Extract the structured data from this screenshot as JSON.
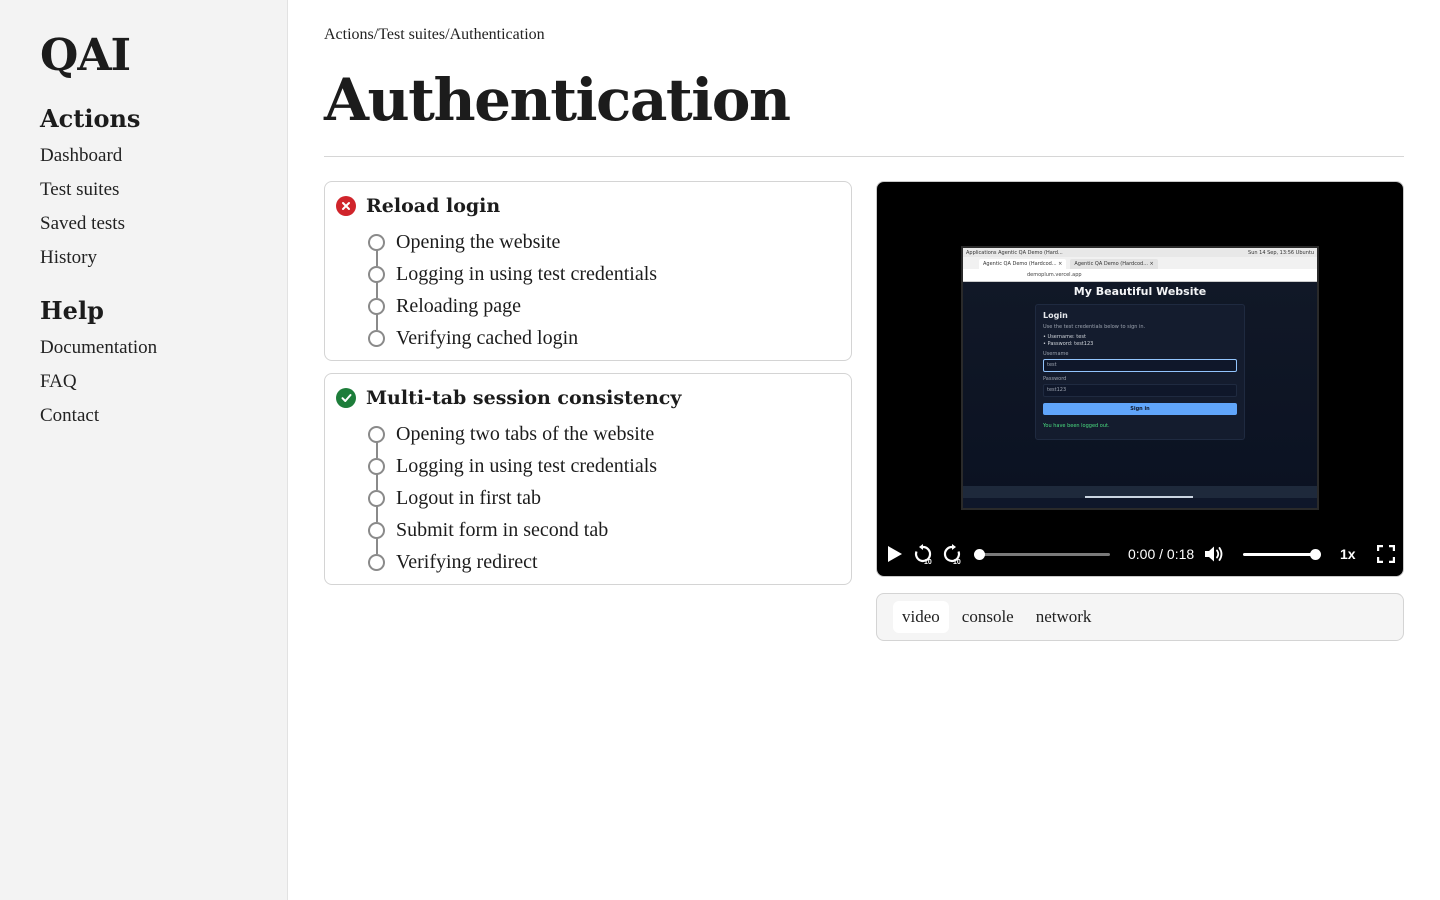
{
  "sidebar": {
    "logo": "QAI",
    "sections": [
      {
        "heading": "Actions",
        "items": [
          "Dashboard",
          "Test suites",
          "Saved tests",
          "History"
        ]
      },
      {
        "heading": "Help",
        "items": [
          "Documentation",
          "FAQ",
          "Contact"
        ]
      }
    ]
  },
  "breadcrumb": [
    "Actions",
    "/",
    "Test suites",
    "/",
    "Authentication"
  ],
  "page_title": "Authentication",
  "tests": [
    {
      "status": "failed",
      "title": "Reload login",
      "steps": [
        "Opening the website",
        "Logging in using test credentials",
        "Reloading page",
        "Verifying cached login"
      ]
    },
    {
      "status": "passed",
      "title": "Multi-tab session consistency",
      "steps": [
        "Opening two tabs of the website",
        "Logging in using test credentials",
        "Logout in first tab",
        "Submit form in second tab",
        "Verifying redirect"
      ]
    }
  ],
  "player": {
    "time": "0:00 / 0:18",
    "speed": "1x",
    "progress": 0.0,
    "volume": 1.0,
    "rewind_label": "10",
    "forward_label": "10",
    "frame": {
      "os_bar_left": "Applications   Agentic QA Demo (Hard...",
      "os_bar_right": "Sun 14 Sep, 13:56  Ubuntu",
      "tab_1": "Agentic QA Demo (Hardcod... ×",
      "tab_2": "Agentic QA Demo (Hardcod... ×",
      "url": "demoplum.vercel.app",
      "site_title": "My Beautiful Website",
      "login_title": "Login",
      "login_hint": "Use the test credentials below to sign in.",
      "cred_user": "• Username: test",
      "cred_pass": "• Password: test123",
      "username_label": "Username",
      "username_value": "test",
      "password_label": "Password",
      "password_value": "test123",
      "sign_in": "Sign in",
      "message": "You have been logged out."
    }
  },
  "bottom_tabs": [
    "video",
    "console",
    "network"
  ],
  "active_tab": "video",
  "colors": {
    "fail": "#d0242b",
    "pass": "#1d7d3a",
    "sidebar_bg": "#f3f3f3"
  }
}
